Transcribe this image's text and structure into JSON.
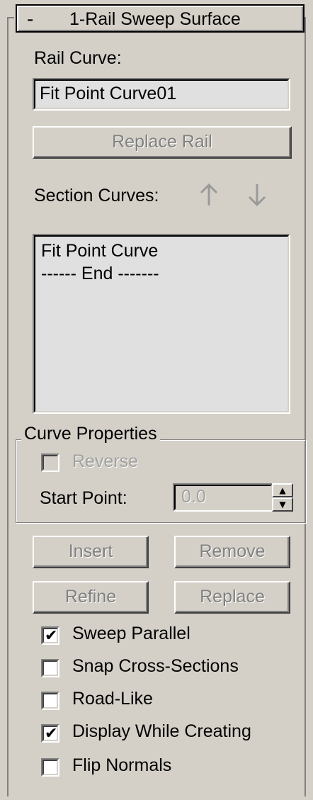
{
  "rollout": {
    "collapse_symbol": "-",
    "title": "1-Rail Sweep Surface"
  },
  "rail": {
    "label": "Rail Curve:",
    "value": "Fit Point Curve01",
    "replace_button": "Replace Rail"
  },
  "sections": {
    "label": "Section Curves:",
    "up_icon": "up-arrow-icon",
    "down_icon": "down-arrow-icon",
    "list_items": [
      "Fit Point Curve",
      "------ End -------"
    ]
  },
  "curve_properties": {
    "group_label": "Curve Properties",
    "reverse_label": "Reverse",
    "reverse_checked": false,
    "start_point_label": "Start Point:",
    "start_point_value": "0.0"
  },
  "buttons": {
    "insert": "Insert",
    "remove": "Remove",
    "refine": "Refine",
    "replace": "Replace"
  },
  "options": [
    {
      "label": "Sweep Parallel",
      "checked": true
    },
    {
      "label": "Snap Cross-Sections",
      "checked": false
    },
    {
      "label": "Road-Like",
      "checked": false
    },
    {
      "label": "Display While Creating",
      "checked": true
    },
    {
      "label": "Flip Normals",
      "checked": false
    }
  ],
  "colors": {
    "panel_bg": "#d4d0c8",
    "field_bg": "#e0e0e0",
    "disabled_text": "#808080"
  }
}
